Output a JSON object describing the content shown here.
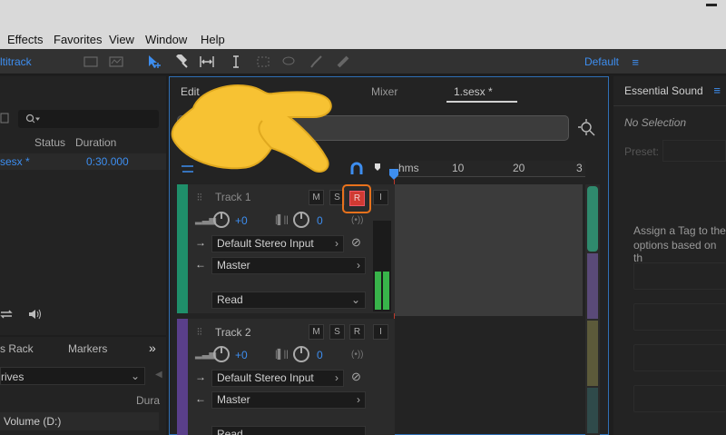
{
  "menu": [
    "Effects",
    "Favorites",
    "View",
    "Window",
    "Help"
  ],
  "toolbar": {
    "mode_label": "ltitrack",
    "workspace": "Default"
  },
  "files_panel": {
    "columns": [
      "Status",
      "Duration"
    ],
    "file_name": "sesx *",
    "file_duration": "0:30.000"
  },
  "media_panel": {
    "tabs": [
      "s Rack",
      "Markers"
    ],
    "dropdown": "rives",
    "column": "Dura",
    "drive": "Volume (D:)"
  },
  "editor": {
    "tabs": [
      "Edit",
      "1.sesx *",
      "Mixer"
    ],
    "ruler": {
      "unit": "hms",
      "ticks": [
        "10",
        "20",
        "3"
      ]
    },
    "tracks": [
      {
        "name": "Track 1",
        "color": "#1f8f6a",
        "volume": "+0",
        "pan": "0",
        "input": "Default Stereo Input",
        "output": "Master",
        "automation": "Read",
        "m": "M",
        "s": "S",
        "r": "R",
        "armed": true
      },
      {
        "name": "Track 2",
        "color": "#5a3f8a",
        "volume": "+0",
        "pan": "0",
        "input": "Default Stereo Input",
        "output": "Master",
        "automation": "Read",
        "m": "M",
        "s": "S",
        "r": "R",
        "armed": false
      }
    ]
  },
  "essential_sound": {
    "title": "Essential Sound",
    "selection": "No Selection",
    "preset_label": "Preset:",
    "assign_text_1": "Assign a Tag to the",
    "assign_text_2": "options based on th"
  },
  "colors": {
    "accent": "#3d8ef0",
    "highlight": "#e8721c",
    "record": "#d03a32",
    "pointer": "#f7c233"
  }
}
